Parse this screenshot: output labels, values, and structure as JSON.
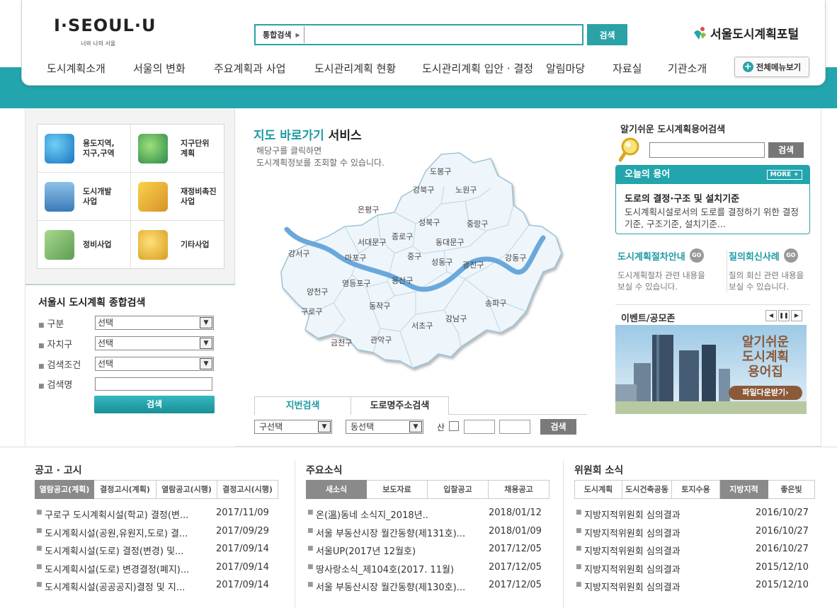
{
  "header": {
    "logo_text": "I·SEOUL·U",
    "logo_tag": "너와 나의 서울",
    "search_scope": "통합검색",
    "search_value": "",
    "search_button": "검색",
    "portal_title": "서울도시계획포털",
    "all_menu": "전체메뉴보기"
  },
  "gnb": [
    "도시계획소개",
    "서울의 변화",
    "주요계획과 사업",
    "도시관리계획 현황",
    "도시관리계획 입안 · 결정",
    "알림마당",
    "자료실",
    "기관소개"
  ],
  "quick_menu": [
    {
      "label": "용도지역,\n지구,구역",
      "icon": "zoning-icon"
    },
    {
      "label": "지구단위\n계획",
      "icon": "district-plan-icon"
    },
    {
      "label": "도시개발\n사업",
      "icon": "urban-development-icon"
    },
    {
      "label": "재정비촉진\n사업",
      "icon": "renewal-icon"
    },
    {
      "label": "정비사업",
      "icon": "maintenance-icon"
    },
    {
      "label": "기타사업",
      "icon": "other-project-icon"
    }
  ],
  "total_search": {
    "title": "서울시 도시계획 종합검색",
    "fields": [
      {
        "label": "구분",
        "value": "선택"
      },
      {
        "label": "자치구",
        "value": "선택"
      },
      {
        "label": "검색조건",
        "value": "선택"
      }
    ],
    "name_label": "검색명",
    "button": "검색"
  },
  "map": {
    "title_accent": "지도 바로가기",
    "title_rest": " 서비스",
    "desc1": "해당구를 클릭하면",
    "desc2": "도시계획정보를 조회할 수 있습니다.",
    "districts": [
      "도봉구",
      "강북구",
      "노원구",
      "은평구",
      "성북구",
      "중랑구",
      "서대문구",
      "종로구",
      "동대문구",
      "강서구",
      "마포구",
      "중구",
      "성동구",
      "광진구",
      "강동구",
      "용산구",
      "양천구",
      "영등포구",
      "구로구",
      "동작구",
      "서초구",
      "강남구",
      "송파구",
      "금천구",
      "관악구"
    ],
    "tab_on": "지번검색",
    "tab_off": "도로명주소검색",
    "select_gu": "구선택",
    "select_dong": "동선택",
    "san_label": "산",
    "button": "검색"
  },
  "right": {
    "term_search_title": "알기쉬운 도시계획용어검색",
    "term_search_button": "검색",
    "today_title": "오늘의 용어",
    "more": "MORE +",
    "today_term": "도로의 결정·구조 및 설치기준",
    "today_desc": "도시계획시설로서의 도로를 결정하기 위한 결정기준, 구조기준, 설치기준...",
    "guide1_title": "도시계획절차안내",
    "guide1_desc": "도시계획절차 관련 내용을 보실 수 있습니다.",
    "guide2_title": "질의회신사례",
    "guide2_desc": "질의 회신 관련 내용을 보실 수 있습니다.",
    "go": "GO",
    "event_title": "이벤트/공모존",
    "banner_l1": "알기쉬운",
    "banner_l2": "도시계획",
    "banner_l3": "용어집",
    "banner_btn": "파일다운받기›"
  },
  "notice": {
    "title": "공고 · 고시",
    "tabs": [
      "열람공고(계획)",
      "결정고시(계획)",
      "열람공고(시행)",
      "결정고시(시행)"
    ],
    "items": [
      {
        "t": "구로구 도시계획시설(학교) 결정(변...",
        "d": "2017/11/09"
      },
      {
        "t": "도시계획시설(공원,유원지,도로) 결...",
        "d": "2017/09/29"
      },
      {
        "t": "도시계획시설(도로) 결정(변경) 및...",
        "d": "2017/09/14"
      },
      {
        "t": "도시계획시설(도로) 변경결정(폐지)...",
        "d": "2017/09/14"
      },
      {
        "t": "도시계획시설(공공공지)결정 및 지...",
        "d": "2017/09/14"
      }
    ]
  },
  "news": {
    "title": "주요소식",
    "tabs": [
      "새소식",
      "보도자료",
      "입찰공고",
      "채용공고"
    ],
    "items": [
      {
        "t": "온(溫)동네 소식지_2018년..",
        "d": "2018/01/12"
      },
      {
        "t": "서울 부동산시장 월간동향(제131호)...",
        "d": "2018/01/09"
      },
      {
        "t": "서울UP(2017년 12월호)",
        "d": "2017/12/05"
      },
      {
        "t": "땅사랑소식_제104호(2017. 11월)",
        "d": "2017/12/05"
      },
      {
        "t": "서울 부동산시장 월간동향(제130호)...",
        "d": "2017/12/05"
      }
    ]
  },
  "committee": {
    "title": "위원회 소식",
    "tabs": [
      "도시계획",
      "도시건축공동",
      "토지수용",
      "지방지적",
      "좋은빛"
    ],
    "items": [
      {
        "t": "지방지적위원회 심의결과",
        "d": "2016/10/27"
      },
      {
        "t": "지방지적위원회 심의결과",
        "d": "2016/10/27"
      },
      {
        "t": "지방지적위원회 심의결과",
        "d": "2016/10/27"
      },
      {
        "t": "지방지적위원회 심의결과",
        "d": "2015/12/10"
      },
      {
        "t": "지방지적위원회 심의결과",
        "d": "2015/12/10"
      }
    ]
  },
  "colors": {
    "accent": "#22a5ad",
    "accent_text": "#1f9aa5",
    "map_fill": "#eef6fb",
    "river": "#6aa8dc"
  }
}
